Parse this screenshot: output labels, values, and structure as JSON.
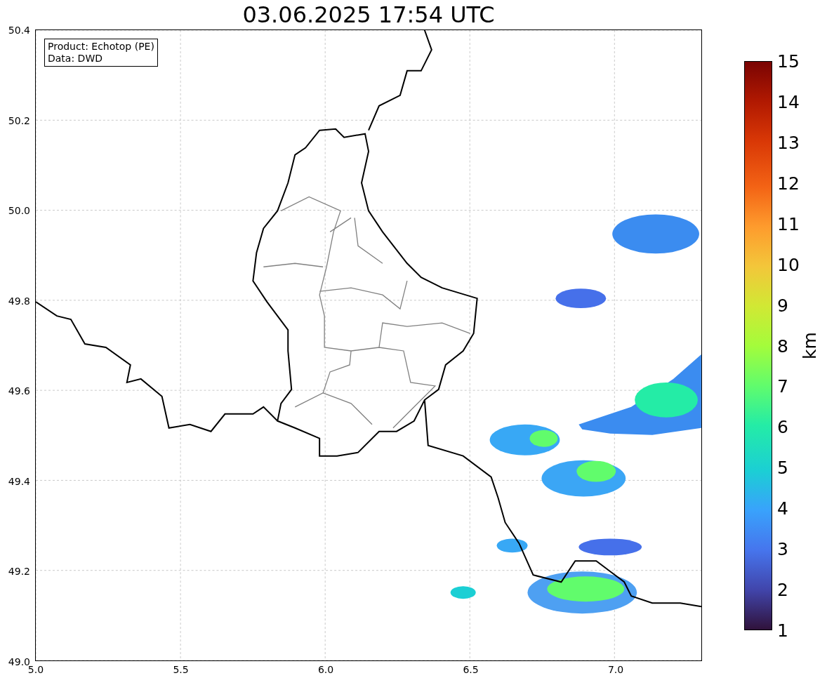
{
  "title": "03.06.2025 17:54 UTC",
  "info_box": {
    "lines": [
      "Product: Echotop (PE)",
      "Data: DWD"
    ]
  },
  "axes": {
    "xticks": [
      "5.0",
      "5.5",
      "6.0",
      "6.5",
      "7.0"
    ],
    "yticks": [
      "50.4",
      "50.2",
      "50.0",
      "49.8",
      "49.6",
      "49.4",
      "49.2",
      "49.0"
    ]
  },
  "colorbar": {
    "label": "km",
    "ticks": [
      "15",
      "14",
      "13",
      "12",
      "11",
      "10",
      "9",
      "8",
      "7",
      "6",
      "5",
      "4",
      "3",
      "2",
      "1"
    ]
  }
}
